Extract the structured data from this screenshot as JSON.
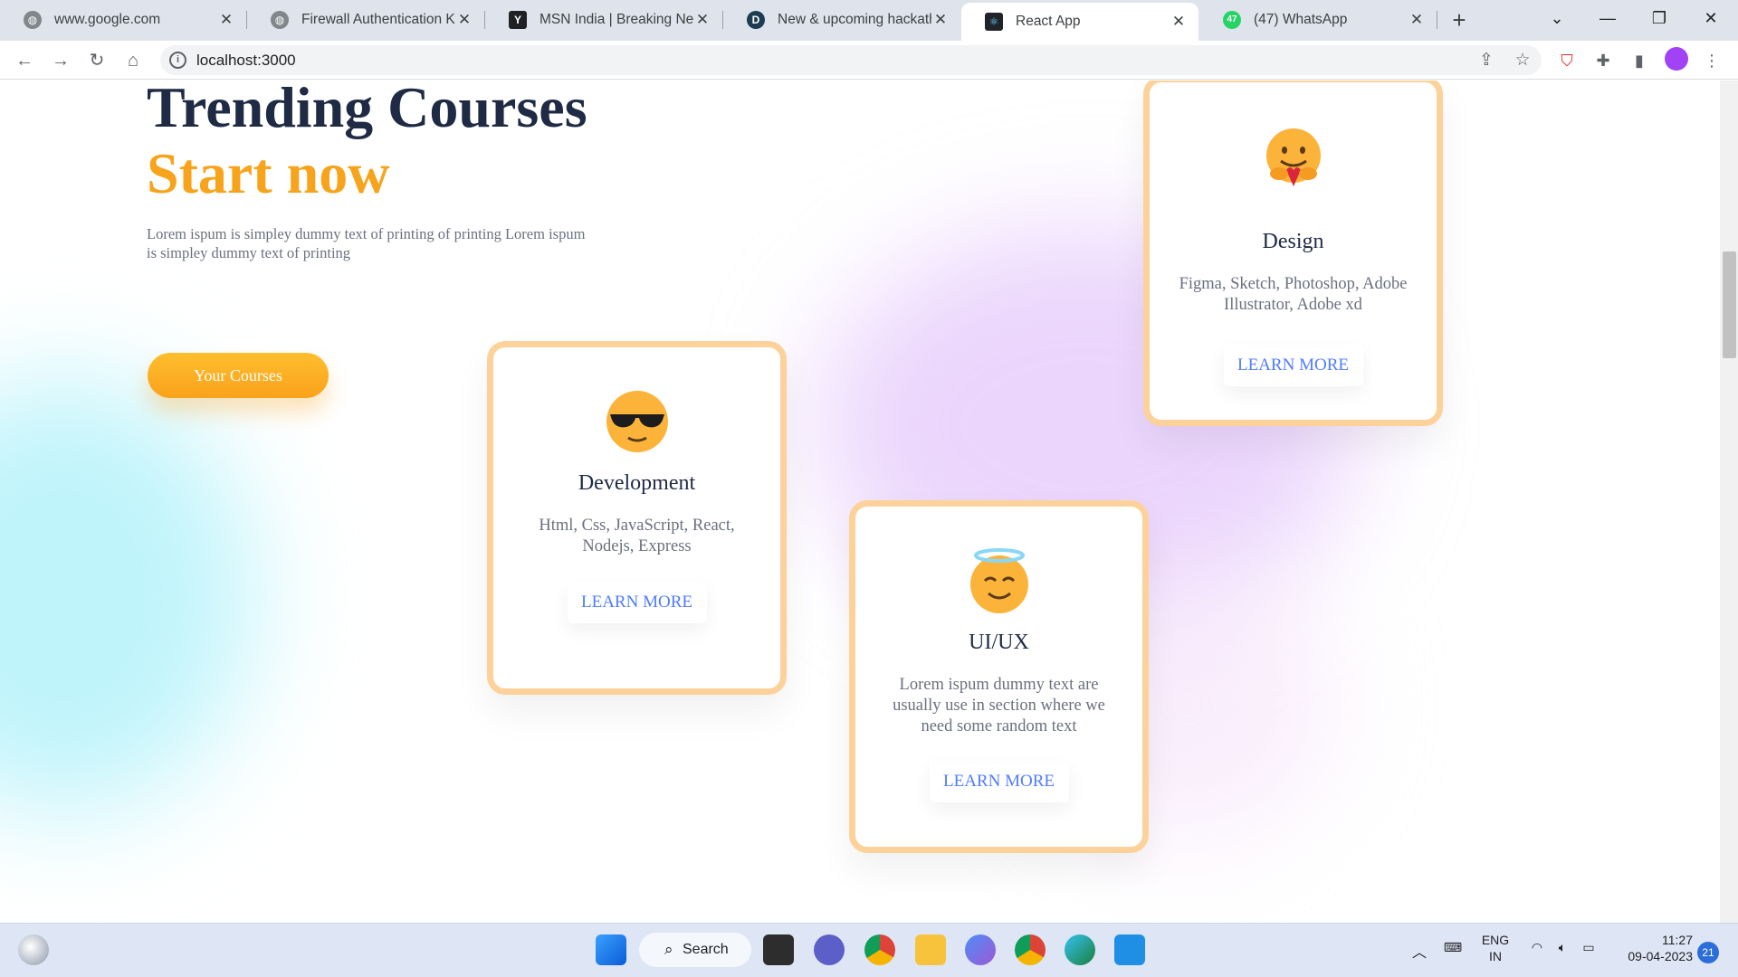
{
  "browser": {
    "tabs": [
      {
        "title": "www.google.com"
      },
      {
        "title": "Firewall Authentication Keep"
      },
      {
        "title": "MSN India | Breaking News"
      },
      {
        "title": "New & upcoming hackathons"
      },
      {
        "title": "React App"
      },
      {
        "title": "(47) WhatsApp"
      }
    ],
    "whatsapp_badge": "47",
    "url": "localhost:3000"
  },
  "hero": {
    "title": "Trending Courses",
    "subtitle": "Start now",
    "text": "Lorem ispum is simpley dummy text of printing of printing Lorem ispum is simpley dummy text of printing",
    "cta_label": "Your Courses"
  },
  "cards": [
    {
      "title": "Design",
      "desc": "Figma, Sketch, Photoshop, Adobe Illustrator, Adobe xd",
      "link": "LEARN MORE",
      "icon": "hugging-face-icon"
    },
    {
      "title": "Development",
      "desc": "Html, Css, JavaScript, React, Nodejs, Express",
      "link": "LEARN MORE",
      "icon": "sunglasses-face-icon"
    },
    {
      "title": "UI/UX",
      "desc": "Lorem ispum dummy text are usually use in section where we need some random text",
      "link": "LEARN MORE",
      "icon": "halo-face-icon"
    }
  ],
  "taskbar": {
    "search_label": "Search",
    "lang_top": "ENG",
    "lang_bottom": "IN",
    "time": "11:27",
    "date": "09-04-2023",
    "notifications": "21"
  },
  "colors": {
    "accent": "#f7a41c",
    "title": "#1f2a44",
    "card_border": "#fdd29a",
    "link": "#4f7cff"
  }
}
